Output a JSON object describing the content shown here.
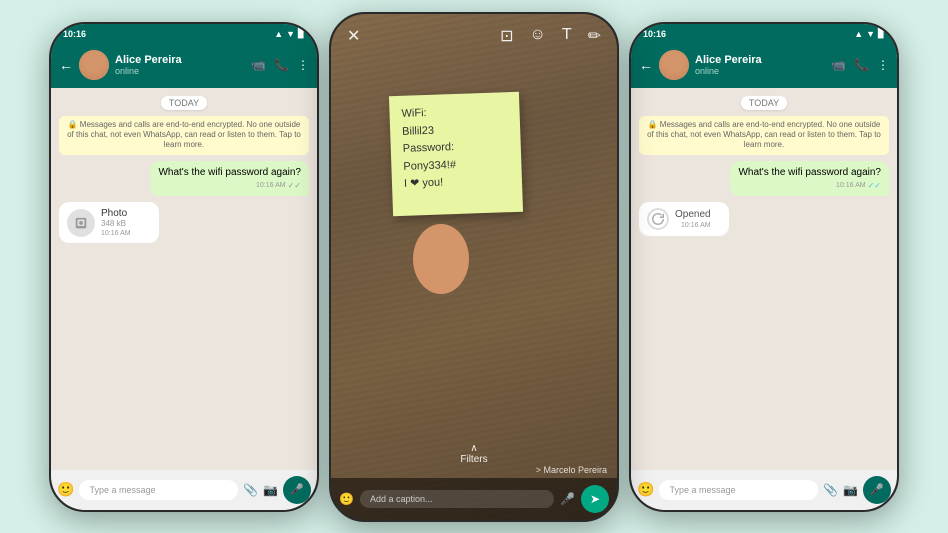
{
  "phones": {
    "left": {
      "status_bar": {
        "time": "10:16",
        "icons": "▲◀ 4G ■"
      },
      "header": {
        "contact_name": "Alice Pereira",
        "status": "online",
        "back_label": "←"
      },
      "chat": {
        "date_badge": "TODAY",
        "encryption_notice": "🔒 Messages and calls are end-to-end encrypted. No one outside of this chat, not even WhatsApp, can read or listen to them. Tap to learn more.",
        "message_out": {
          "text": "What's the wifi password again?",
          "time": "10:16 AM",
          "status": "✓✓"
        },
        "message_in": {
          "icon": "📷",
          "title": "Photo",
          "size": "348 kB",
          "time": "10:16 AM"
        }
      },
      "input": {
        "placeholder": "Type a message",
        "mic_icon": "🎤"
      }
    },
    "middle": {
      "toolbar": {
        "close": "✕",
        "crop": "⊡",
        "emoji": "☺",
        "text": "T",
        "edit": "✏"
      },
      "sticky_note": {
        "line1": "WiFi:",
        "line2": "Billil23",
        "line3": "Password:",
        "line4": "Pony334!#",
        "line5": "I ❤ you!"
      },
      "filters": "Filters",
      "caption_placeholder": "Add a caption...",
      "sender": "> Marcelo Pereira",
      "send_icon": "➤"
    },
    "right": {
      "status_bar": {
        "time": "10:16"
      },
      "header": {
        "contact_name": "Alice Pereira",
        "status": "online"
      },
      "chat": {
        "date_badge": "TODAY",
        "encryption_notice": "🔒 Messages and calls are end-to-end encrypted. No one outside of this chat, not even WhatsApp, can read or listen to them. Tap to learn more.",
        "message_out": {
          "text": "What's the wifi password again?",
          "time": "10:16 AM",
          "status": "✓✓"
        },
        "message_in": {
          "icon": "↺",
          "title": "Opened",
          "time": "10:16 AM"
        }
      },
      "input": {
        "placeholder": "Type a message"
      }
    }
  }
}
